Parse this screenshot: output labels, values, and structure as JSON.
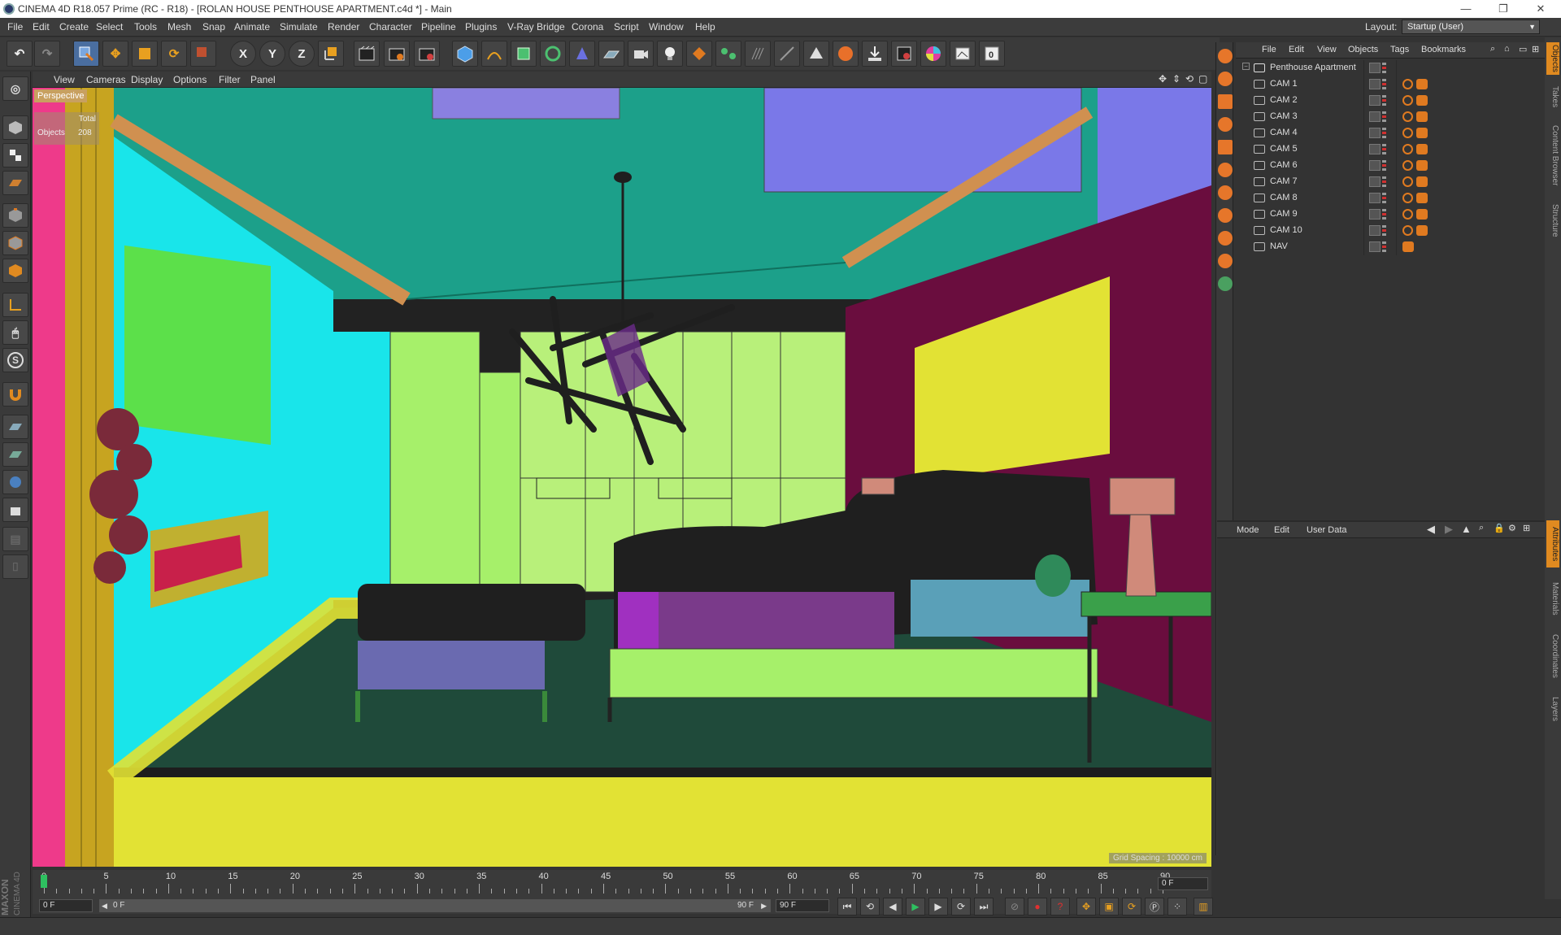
{
  "window": {
    "title": "CINEMA 4D R18.057 Prime (RC - R18) - [ROLAN HOUSE PENTHOUSE APARTMENT.c4d *] - Main",
    "minimize": "—",
    "restore": "❐",
    "close": "✕"
  },
  "menu": [
    "File",
    "Edit",
    "Create",
    "Select",
    "Tools",
    "Mesh",
    "Snap",
    "Animate",
    "Simulate",
    "Render",
    "Character",
    "Pipeline",
    "Plugins",
    "V-Ray Bridge",
    "Corona",
    "Script",
    "Window",
    "Help"
  ],
  "layout": {
    "label": "Layout:",
    "value": "Startup (User)"
  },
  "toolbar": {
    "axis_x": "X",
    "axis_y": "Y",
    "axis_z": "Z"
  },
  "viewport": {
    "menu": [
      "View",
      "Cameras",
      "Display",
      "Options",
      "Filter",
      "Panel"
    ],
    "camera_label": "Perspective",
    "stats_total": "Total",
    "stats_objects_label": "Objects",
    "stats_objects_value": "208",
    "grid_spacing": "Grid Spacing : 10000 cm"
  },
  "object_manager": {
    "menu": [
      "File",
      "Edit",
      "View",
      "Objects",
      "Tags",
      "Bookmarks"
    ],
    "objects": [
      {
        "name": "Penthouse Apartment",
        "type": "null"
      },
      {
        "name": "CAM 1",
        "type": "camera"
      },
      {
        "name": "CAM 2",
        "type": "camera"
      },
      {
        "name": "CAM 3",
        "type": "camera"
      },
      {
        "name": "CAM 4",
        "type": "camera"
      },
      {
        "name": "CAM 5",
        "type": "camera"
      },
      {
        "name": "CAM 6",
        "type": "camera"
      },
      {
        "name": "CAM 7",
        "type": "camera"
      },
      {
        "name": "CAM 8",
        "type": "camera"
      },
      {
        "name": "CAM 9",
        "type": "camera"
      },
      {
        "name": "CAM 10",
        "type": "camera"
      },
      {
        "name": "NAV",
        "type": "camera"
      }
    ]
  },
  "attribute_manager": {
    "menu": [
      "Mode",
      "Edit",
      "User Data"
    ]
  },
  "side_tabs_top": [
    "Objects",
    "Takes",
    "Content Browser",
    "Structure"
  ],
  "side_tabs_bottom": [
    "Attributes",
    "Materials",
    "Coordinates",
    "Layers"
  ],
  "timeline": {
    "labels": [
      "0",
      "5",
      "10",
      "15",
      "20",
      "25",
      "30",
      "35",
      "40",
      "45",
      "50",
      "55",
      "60",
      "65",
      "70",
      "75",
      "80",
      "85",
      "90"
    ],
    "current_frame_right": "0 F"
  },
  "playback": {
    "start_frame": "0 F",
    "range_start": "0 F",
    "range_end": "90 F",
    "end_frame": "90 F"
  },
  "logo": {
    "text": "MAXON CINEMA 4D"
  },
  "colors": {
    "accent": "#e07a20",
    "panel_bg": "#333333"
  }
}
